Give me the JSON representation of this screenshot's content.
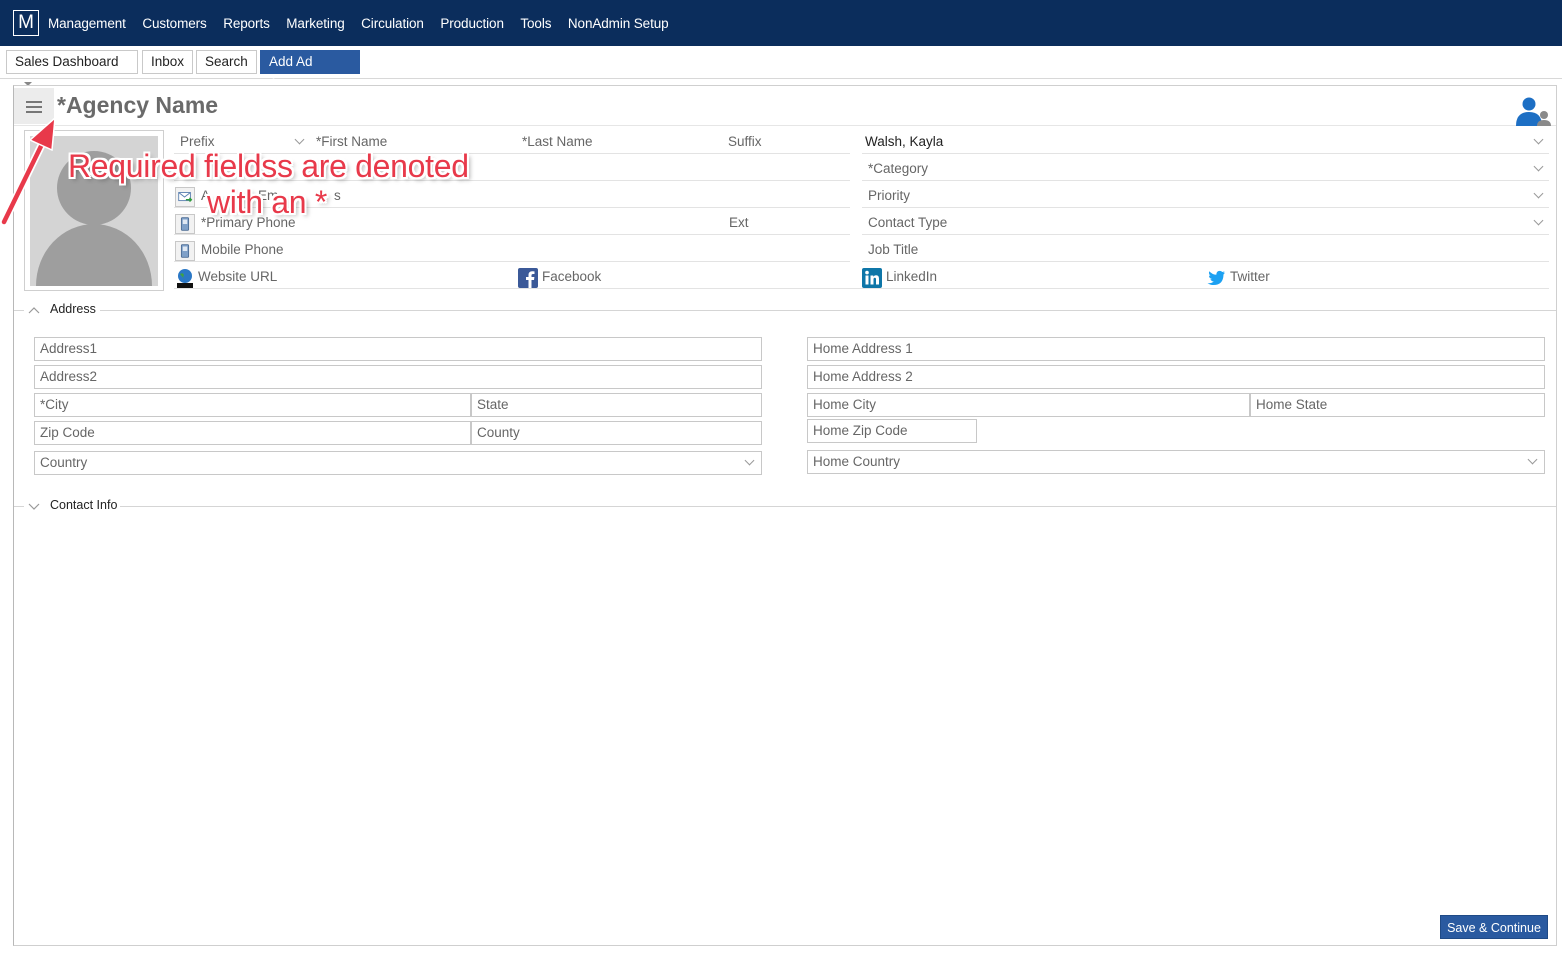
{
  "app": {
    "logo_letter": "M",
    "menu": [
      "Management",
      "Customers",
      "Reports",
      "Marketing",
      "Circulation",
      "Production",
      "Tools",
      "NonAdmin Setup"
    ]
  },
  "tabs": [
    {
      "label": "Sales Dashboard"
    },
    {
      "label": "Inbox"
    },
    {
      "label": "Search"
    },
    {
      "label": "Add Ad A...",
      "close": "×"
    }
  ],
  "form": {
    "title": "*Agency Name",
    "name_row": {
      "prefix": "Prefix",
      "first": "*First Name",
      "last": "*Last Name",
      "suffix": "Suffix"
    },
    "primary_phone": "*Primary Phone",
    "ext": "Ext",
    "mobile": "Mobile Phone",
    "email_partial_a": "A",
    "email_partial_b": "Em",
    "email_partial_c": "s",
    "website": "Website URL",
    "facebook": "Facebook",
    "linkedin": "LinkedIn",
    "twitter": "Twitter",
    "rep": "Walsh, Kayla",
    "category": "*Category",
    "priority": "Priority",
    "contact_type": "Contact Type",
    "job_title": "Job Title"
  },
  "address": {
    "section_label": "Address",
    "address1": "Address1",
    "address2": "Address2",
    "city": "*City",
    "state": "State",
    "zip": "Zip Code",
    "county": "County",
    "country": "Country",
    "home_address1": "Home Address 1",
    "home_address2": "Home Address 2",
    "home_city": "Home City",
    "home_state": "Home State",
    "home_zip": "Home Zip Code",
    "home_country": "Home Country"
  },
  "contact_info": {
    "section_label": "Contact Info"
  },
  "save_button": "Save & Continue",
  "annotation": {
    "line1": "Required fieldss are denoted",
    "line2": "with an *",
    "color": "#e8394a"
  },
  "colors": {
    "nav_bg": "#0b2d5c",
    "accent": "#2a5aa0"
  }
}
